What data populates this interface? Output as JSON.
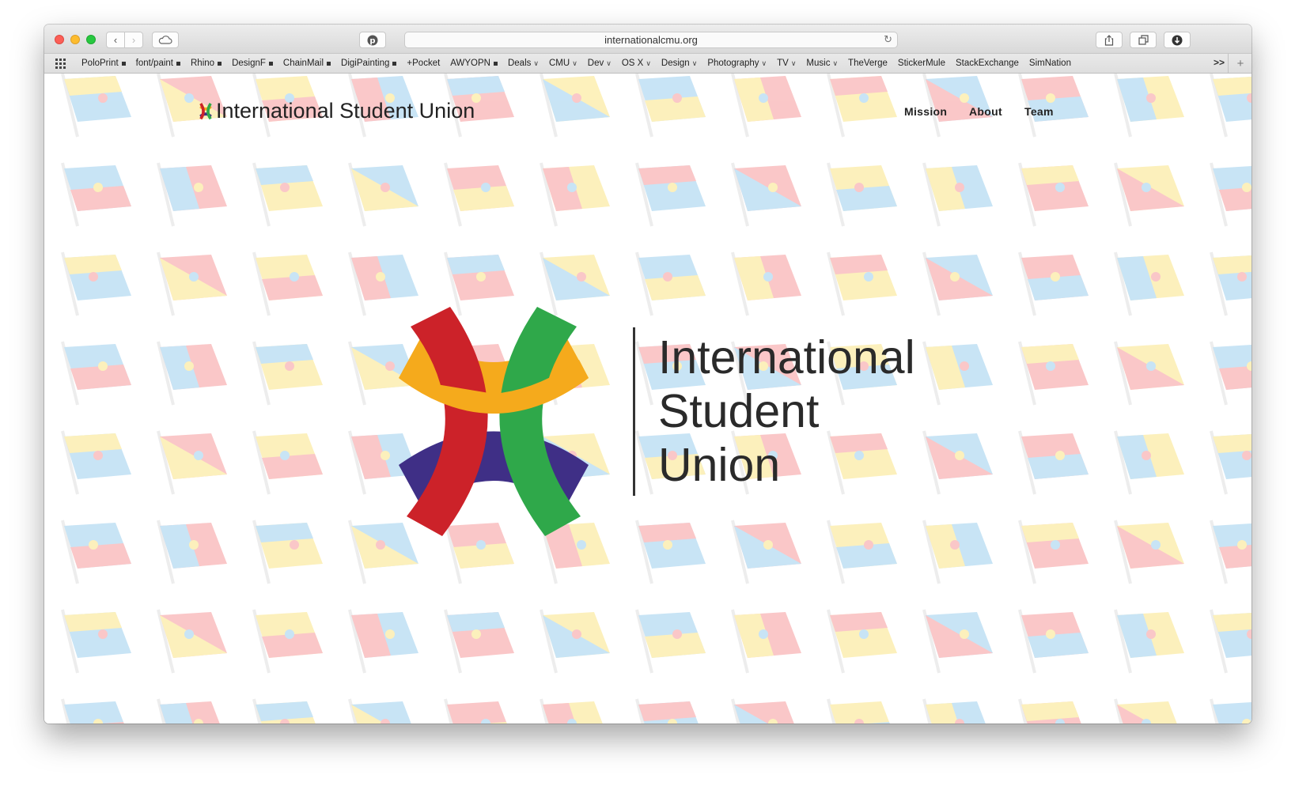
{
  "browser": {
    "url": "internationalcmu.org",
    "bookmarks": [
      {
        "label": "PoloPrint",
        "marker": "square"
      },
      {
        "label": "font/paint",
        "marker": "square"
      },
      {
        "label": "Rhino",
        "marker": "square"
      },
      {
        "label": "DesignF",
        "marker": "square"
      },
      {
        "label": "ChainMail",
        "marker": "square"
      },
      {
        "label": "DigiPainting",
        "marker": "square"
      },
      {
        "label": "+Pocket",
        "marker": "none"
      },
      {
        "label": "AWYOPN",
        "marker": "square"
      },
      {
        "label": "Deals",
        "marker": "chevron"
      },
      {
        "label": "CMU",
        "marker": "chevron"
      },
      {
        "label": "Dev",
        "marker": "chevron"
      },
      {
        "label": "OS X",
        "marker": "chevron"
      },
      {
        "label": "Design",
        "marker": "chevron"
      },
      {
        "label": "Photography",
        "marker": "chevron"
      },
      {
        "label": "TV",
        "marker": "chevron"
      },
      {
        "label": "Music",
        "marker": "chevron"
      },
      {
        "label": "TheVerge",
        "marker": "none"
      },
      {
        "label": "StickerMule",
        "marker": "none"
      },
      {
        "label": "StackExchange",
        "marker": "none"
      },
      {
        "label": "SimNation",
        "marker": "none"
      }
    ],
    "overflow_label": ">>"
  },
  "site": {
    "logo_text": "International Student Union",
    "nav": {
      "mission": "Mission",
      "about": "About",
      "team": "Team"
    },
    "hero": {
      "line1": "International",
      "line2": "Student",
      "line3": "Union"
    }
  },
  "colors": {
    "red": "#cc2229",
    "orange": "#f5aa1c",
    "green": "#2fa84a",
    "purple": "#3f2f86",
    "flag_red": "#f0595b",
    "flag_yellow": "#f7d436",
    "flag_blue": "#5aaee2"
  },
  "icons": [
    "back-arrow-icon",
    "forward-arrow-icon",
    "icloud-icon",
    "pinterest-icon",
    "reload-icon",
    "share-icon",
    "tabs-icon",
    "download-icon",
    "grid-icon"
  ]
}
